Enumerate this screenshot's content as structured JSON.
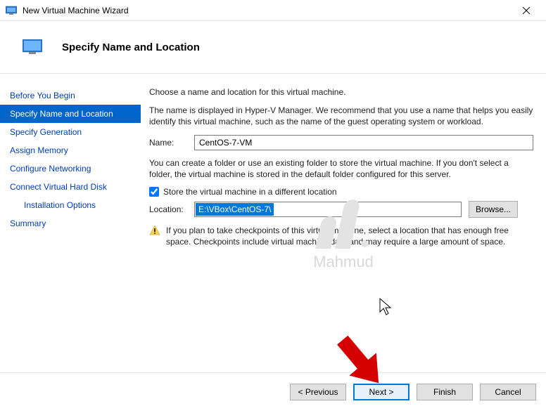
{
  "window": {
    "title": "New Virtual Machine Wizard",
    "close_label": "Close"
  },
  "header": {
    "title": "Specify Name and Location"
  },
  "sidebar": {
    "steps": [
      {
        "key": "before",
        "label": "Before You Begin",
        "indent": 0
      },
      {
        "key": "namelocation",
        "label": "Specify Name and Location",
        "indent": 0,
        "selected": true
      },
      {
        "key": "generation",
        "label": "Specify Generation",
        "indent": 0
      },
      {
        "key": "memory",
        "label": "Assign Memory",
        "indent": 0
      },
      {
        "key": "network",
        "label": "Configure Networking",
        "indent": 0
      },
      {
        "key": "vhd",
        "label": "Connect Virtual Hard Disk",
        "indent": 0
      },
      {
        "key": "install",
        "label": "Installation Options",
        "indent": 1
      },
      {
        "key": "summary",
        "label": "Summary",
        "indent": 0
      }
    ]
  },
  "content": {
    "intro": "Choose a name and location for this virtual machine.",
    "name_desc": "The name is displayed in Hyper-V Manager. We recommend that you use a name that helps you easily identify this virtual machine, such as the name of the guest operating system or workload.",
    "name_label": "Name:",
    "name_value": "CentOS-7-VM",
    "loc_intro": "You can create a folder or use an existing folder to store the virtual machine. If you don't select a folder, the virtual machine is stored in the default folder configured for this server.",
    "store_checkbox_label": "Store the virtual machine in a different location",
    "store_checked": true,
    "location_label": "Location:",
    "location_value": "E:\\VBox\\CentOS-7\\",
    "browse_label": "Browse...",
    "warning": "If you plan to take checkpoints of this virtual machine, select a location that has enough free space. Checkpoints include virtual machine data and may require a large amount of space."
  },
  "footer": {
    "previous": "< Previous",
    "next": "Next >",
    "finish": "Finish",
    "cancel": "Cancel"
  },
  "watermark": {
    "text": "Mahmud"
  }
}
